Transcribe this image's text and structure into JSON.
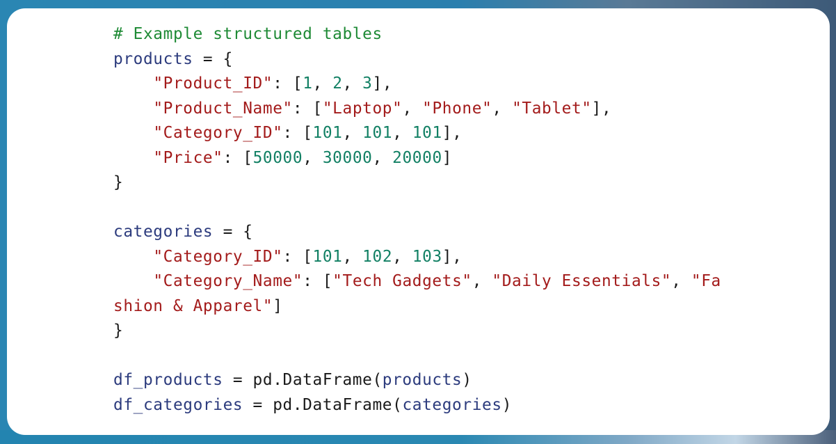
{
  "code": {
    "language": "python",
    "lines": [
      [
        {
          "t": "c",
          "text": "# Example structured tables"
        }
      ],
      [
        {
          "t": "v",
          "text": "products"
        },
        {
          "t": "p",
          "text": " = {"
        }
      ],
      [
        {
          "t": "p",
          "text": "    "
        },
        {
          "t": "s",
          "text": "\"Product_ID\""
        },
        {
          "t": "p",
          "text": ": ["
        },
        {
          "t": "n",
          "text": "1"
        },
        {
          "t": "p",
          "text": ", "
        },
        {
          "t": "n",
          "text": "2"
        },
        {
          "t": "p",
          "text": ", "
        },
        {
          "t": "n",
          "text": "3"
        },
        {
          "t": "p",
          "text": "],"
        }
      ],
      [
        {
          "t": "p",
          "text": "    "
        },
        {
          "t": "s",
          "text": "\"Product_Name\""
        },
        {
          "t": "p",
          "text": ": ["
        },
        {
          "t": "s",
          "text": "\"Laptop\""
        },
        {
          "t": "p",
          "text": ", "
        },
        {
          "t": "s",
          "text": "\"Phone\""
        },
        {
          "t": "p",
          "text": ", "
        },
        {
          "t": "s",
          "text": "\"Tablet\""
        },
        {
          "t": "p",
          "text": "],"
        }
      ],
      [
        {
          "t": "p",
          "text": "    "
        },
        {
          "t": "s",
          "text": "\"Category_ID\""
        },
        {
          "t": "p",
          "text": ": ["
        },
        {
          "t": "n",
          "text": "101"
        },
        {
          "t": "p",
          "text": ", "
        },
        {
          "t": "n",
          "text": "101"
        },
        {
          "t": "p",
          "text": ", "
        },
        {
          "t": "n",
          "text": "101"
        },
        {
          "t": "p",
          "text": "],"
        }
      ],
      [
        {
          "t": "p",
          "text": "    "
        },
        {
          "t": "s",
          "text": "\"Price\""
        },
        {
          "t": "p",
          "text": ": ["
        },
        {
          "t": "n",
          "text": "50000"
        },
        {
          "t": "p",
          "text": ", "
        },
        {
          "t": "n",
          "text": "30000"
        },
        {
          "t": "p",
          "text": ", "
        },
        {
          "t": "n",
          "text": "20000"
        },
        {
          "t": "p",
          "text": "]"
        }
      ],
      [
        {
          "t": "p",
          "text": "}"
        }
      ],
      [],
      [
        {
          "t": "v",
          "text": "categories"
        },
        {
          "t": "p",
          "text": " = {"
        }
      ],
      [
        {
          "t": "p",
          "text": "    "
        },
        {
          "t": "s",
          "text": "\"Category_ID\""
        },
        {
          "t": "p",
          "text": ": ["
        },
        {
          "t": "n",
          "text": "101"
        },
        {
          "t": "p",
          "text": ", "
        },
        {
          "t": "n",
          "text": "102"
        },
        {
          "t": "p",
          "text": ", "
        },
        {
          "t": "n",
          "text": "103"
        },
        {
          "t": "p",
          "text": "],"
        }
      ],
      [
        {
          "t": "p",
          "text": "    "
        },
        {
          "t": "s",
          "text": "\"Category_Name\""
        },
        {
          "t": "p",
          "text": ": ["
        },
        {
          "t": "s",
          "text": "\"Tech Gadgets\""
        },
        {
          "t": "p",
          "text": ", "
        },
        {
          "t": "s",
          "text": "\"Daily Essentials\""
        },
        {
          "t": "p",
          "text": ", "
        },
        {
          "t": "s",
          "text": "\"Fa"
        }
      ],
      [
        {
          "t": "s",
          "text": "shion & Apparel\""
        },
        {
          "t": "p",
          "text": "]"
        }
      ],
      [
        {
          "t": "p",
          "text": "}"
        }
      ],
      [],
      [
        {
          "t": "v",
          "text": "df_products"
        },
        {
          "t": "p",
          "text": " = pd.DataFrame("
        },
        {
          "t": "v",
          "text": "products"
        },
        {
          "t": "p",
          "text": ")"
        }
      ],
      [
        {
          "t": "v",
          "text": "df_categories"
        },
        {
          "t": "p",
          "text": " = pd.DataFrame("
        },
        {
          "t": "v",
          "text": "categories"
        },
        {
          "t": "p",
          "text": ")"
        }
      ]
    ]
  },
  "colors": {
    "comment": "#1e8a35",
    "variable": "#2c3b7d",
    "string": "#a31b1b",
    "number": "#128064",
    "punctuation": "#1a1a1a",
    "card_background": "#ffffff",
    "page_background": "#2a86b3"
  }
}
